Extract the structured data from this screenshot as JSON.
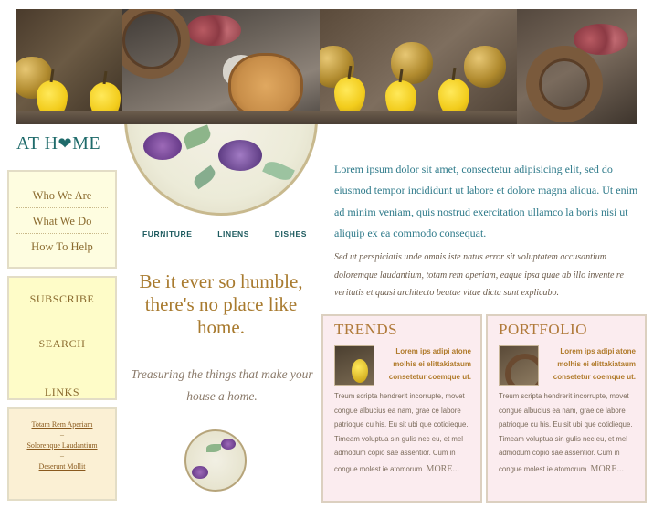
{
  "site": {
    "logo_prefix": "AT H",
    "logo_suffix": "ME"
  },
  "nav": {
    "items": [
      "Who We Are",
      "What We Do",
      "How To Help"
    ]
  },
  "features": {
    "items": [
      "SUBSCRIBE",
      "SEARCH",
      "LINKS"
    ]
  },
  "links": {
    "items": [
      "Totam Rem Aperiam",
      "Solorenque Laudantium",
      "Deserunt Mollit"
    ]
  },
  "categories": [
    "FURNITURE",
    "LINENS",
    "DISHES"
  ],
  "tagline": "Be it ever so humble, there's no place like home.",
  "subtagline": "Treasuring the things that make your house a home.",
  "intro": {
    "lede": "Lorem ipsum dolor sit amet, consectetur adipisicing elit, sed do eiusmod tempor incididunt ut labore et dolore magna aliqua. Ut enim ad minim veniam, quis nostrud exercitation ullamco la boris nisi ut aliquip ex ea commodo consequat.",
    "secondary": "Sed ut perspiciatis unde omnis iste natus error sit voluptatem accusantium doloremque laudantium, totam rem aperiam, eaque ipsa quae ab illo invente re veritatis et quasi architecto beatae vitae dicta sunt explicabo."
  },
  "cards": [
    {
      "title": "TRENDS",
      "lead": "Lorem ips adipi atone molhis ei elittakiataum consetetur coemque ut.",
      "body": "Treum scripta hendrerit incorrupte, movet congue albucius ea nam, grae ce labore patrioque cu his. Eu sit ubi que cotidieque. Timeam voluptua sin gulis nec eu, et mel admodum copio sae assentior. Cum in congue molest ie atomorum.",
      "more": "MORE..."
    },
    {
      "title": "PORTFOLIO",
      "lead": "Lorem ips adipi atone molhis ei elittakiataum consetetur coemque ut.",
      "body": "Treum scripta hendrerit incorrupte, movet congue albucius ea nam, grae ce labore patrioque cu his. Eu sit ubi que cotidieque. Timeam voluptua sin gulis nec eu, et mel admodum copio sae assentior. Cum in congue molest ie atomorum.",
      "more": "MORE..."
    }
  ],
  "colors": {
    "teal": "#1f6b6b",
    "gold": "#a87a2e",
    "nav_bg": "#fefde0",
    "feature_bg": "#fefcc8",
    "card_bg": "#fbecef"
  }
}
